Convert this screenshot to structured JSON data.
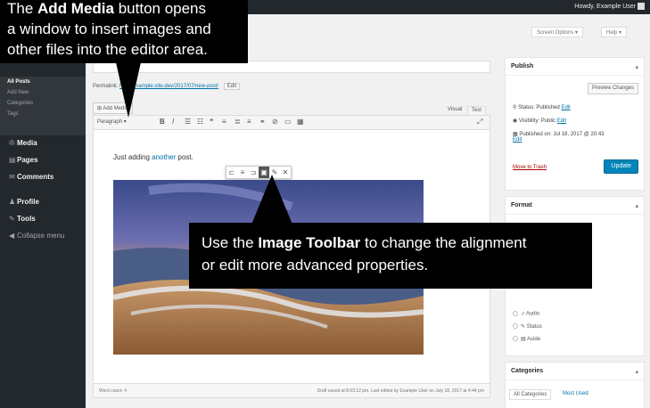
{
  "admin_bar": {
    "howdy": "Howdy, Example User"
  },
  "sidebar": {
    "submenu": [
      "All Posts",
      "Add New",
      "Categories",
      "Tags"
    ],
    "menu": [
      {
        "label": "Media",
        "icon": "media-icon",
        "glyph": "✇"
      },
      {
        "label": "Pages",
        "icon": "pages-icon",
        "glyph": "▤"
      },
      {
        "label": "Comments",
        "icon": "comments-icon",
        "glyph": "✉"
      },
      {
        "label": "Profile",
        "icon": "profile-icon",
        "glyph": "♟"
      },
      {
        "label": "Tools",
        "icon": "tools-icon",
        "glyph": "✎"
      },
      {
        "label": "Collapse menu",
        "icon": "collapse-icon",
        "glyph": "◀"
      }
    ]
  },
  "header": {
    "screen_options": "Screen Options ▾",
    "help": "Help ▾"
  },
  "editor": {
    "permalink_label": "Permalink:",
    "permalink_url": "http://example.site.dev/2017/07/new-post/",
    "permalink_edit": "Edit",
    "add_media": "Add Media",
    "tab_visual": "Visual",
    "tab_text": "Text",
    "format_select": "Paragraph",
    "toolbar_icons": [
      {
        "name": "format-select-icon",
        "glyph": "▾"
      },
      {
        "name": "bold-icon",
        "glyph": "B"
      },
      {
        "name": "italic-icon",
        "glyph": "I"
      },
      {
        "name": "bullet-list-icon",
        "glyph": "☰"
      },
      {
        "name": "numbered-list-icon",
        "glyph": "☷"
      },
      {
        "name": "blockquote-icon",
        "glyph": "❝"
      },
      {
        "name": "align-left-icon",
        "glyph": "≡"
      },
      {
        "name": "align-center-icon",
        "glyph": "≣"
      },
      {
        "name": "align-right-icon",
        "glyph": "≡"
      },
      {
        "name": "link-icon",
        "glyph": "⚭"
      },
      {
        "name": "unlink-icon",
        "glyph": "⊘"
      },
      {
        "name": "more-icon",
        "glyph": "▭"
      },
      {
        "name": "toolbar-toggle-icon",
        "glyph": "▦"
      }
    ],
    "fullscreen_glyph": "⤢",
    "content_before": "Just adding ",
    "content_highlight": "another",
    "content_after": " post.",
    "image_toolbar": [
      {
        "name": "image-align-left-icon",
        "glyph": "⊏",
        "selected": false
      },
      {
        "name": "image-align-center-icon",
        "glyph": "≡",
        "selected": false
      },
      {
        "name": "image-align-right-icon",
        "glyph": "⊐",
        "selected": false
      },
      {
        "name": "image-align-none-icon",
        "glyph": "▣",
        "selected": true
      },
      {
        "name": "image-edit-icon",
        "glyph": "✎",
        "selected": false
      },
      {
        "name": "image-remove-icon",
        "glyph": "✕",
        "selected": false
      }
    ],
    "word_count": "Word count: 4",
    "draft_saved": "Draft saved at 8:03:12 pm. Last edited by Example User on July 18, 2017 at 4:44 pm"
  },
  "publish": {
    "title": "Publish",
    "preview": "Preview Changes",
    "status": "Status: Published",
    "status_edit": "Edit",
    "visibility": "Visibility: Public",
    "visibility_edit": "Edit",
    "published_on": "Published on: Jul 18, 2017 @ 20:43",
    "published_edit": "Edit",
    "trash": "Move to Trash",
    "update": "Update"
  },
  "format": {
    "title": "Format",
    "options": [
      "Audio",
      "Status",
      "Aside"
    ]
  },
  "categories": {
    "title": "Categories",
    "tab_all": "All Categories",
    "tab_most": "Most Used"
  },
  "callouts": {
    "add_media_pre": "The ",
    "add_media_bold": "Add Media",
    "add_media_post": " button opens",
    "add_media_line2": "a window to insert images and",
    "add_media_line3": "other files into the editor area.",
    "toolbar_pre": "Use the ",
    "toolbar_bold": "Image Toolbar",
    "toolbar_post": " to change the alignment",
    "toolbar_line2": "or edit more advanced properties."
  }
}
